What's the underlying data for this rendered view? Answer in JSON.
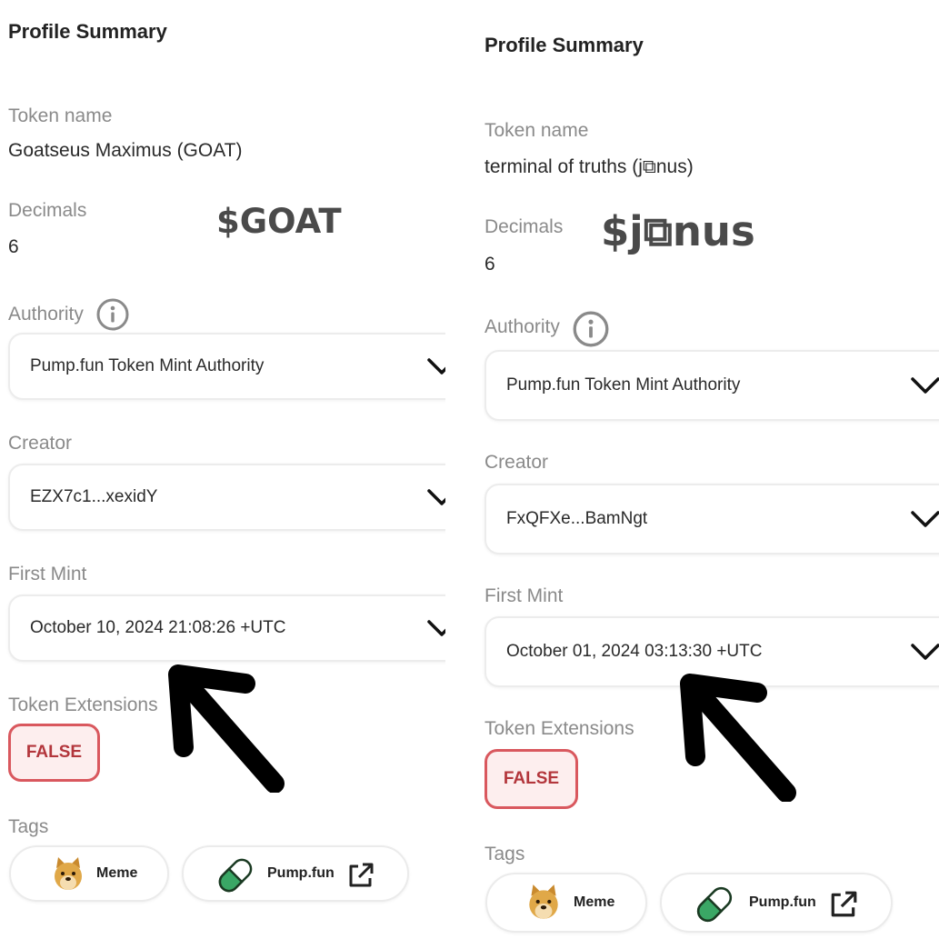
{
  "panels": [
    {
      "title": "Profile Summary",
      "token_name_label": "Token name",
      "token_name": "Goatseus Maximus (GOAT)",
      "decimals_label": "Decimals",
      "decimals": "6",
      "ticker": "$GOAT",
      "authority_label": "Authority",
      "authority": "Pump.fun Token Mint Authority",
      "creator_label": "Creator",
      "creator": "EZX7c1...xexidY",
      "first_mint_label": "First Mint",
      "first_mint": "October 10, 2024 21:08:26 +UTC",
      "extensions_label": "Token Extensions",
      "extensions_value": "FALSE",
      "tags_label": "Tags",
      "tags": [
        "Meme",
        "Pump.fun"
      ]
    },
    {
      "title": "Profile Summary",
      "token_name_label": "Token name",
      "token_name": "terminal of truths (j⧉nus)",
      "decimals_label": "Decimals",
      "decimals": "6",
      "ticker": "$j⧉nus",
      "authority_label": "Authority",
      "authority": "Pump.fun Token Mint Authority",
      "creator_label": "Creator",
      "creator": "FxQFXe...BamNgt",
      "first_mint_label": "First Mint",
      "first_mint": "October 01, 2024 03:13:30 +UTC",
      "extensions_label": "Token Extensions",
      "extensions_value": "FALSE",
      "tags_label": "Tags",
      "tags": [
        "Meme",
        "Pump.fun"
      ]
    }
  ],
  "colors": {
    "label_gray": "#8a8a8a",
    "badge_border": "#d9585e",
    "badge_bg": "#fdeeee",
    "pill_green": "#3aa765",
    "arrow": "#000000"
  },
  "icons": [
    "info-icon",
    "chevron-down-icon",
    "doge-icon",
    "pill-icon",
    "external-link-icon",
    "arrow-annotation"
  ]
}
